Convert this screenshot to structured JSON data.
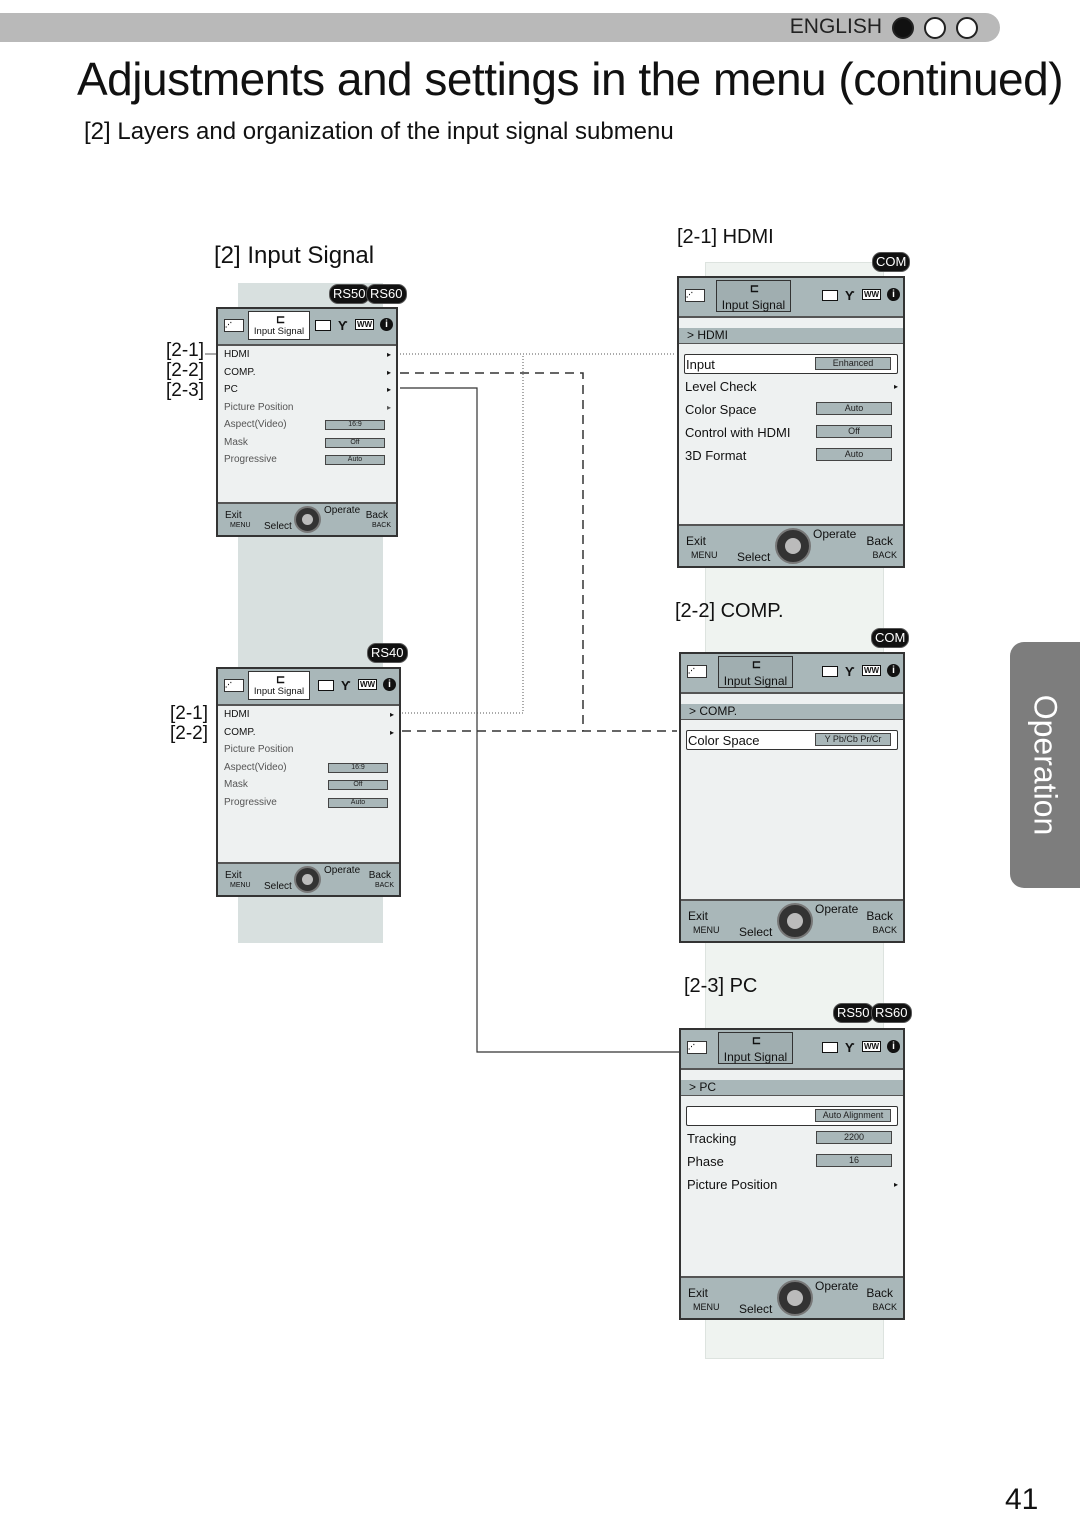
{
  "header": {
    "language": "ENGLISH",
    "language_dots": [
      true,
      false,
      false
    ]
  },
  "title": "Adjustments and settings in the menu (continued)",
  "subtitle": "[2] Layers and organization of the input signal submenu",
  "section_labels": {
    "input_signal": "[2] Input Signal",
    "hdmi": "[2-1] HDMI",
    "comp": "[2-2] COMP.",
    "pc": "[2-3] PC"
  },
  "callouts": {
    "top": [
      "[2-1]",
      "[2-2]",
      "[2-3]"
    ],
    "bottom": [
      "[2-1]",
      "[2-2]"
    ]
  },
  "badges": {
    "rs50": "RS50",
    "rs60": "RS60",
    "rs40": "RS40",
    "com": "COM"
  },
  "side_tab": "Operation",
  "page_number": "41",
  "icons": [
    "picture-adjust-icon",
    "input-signal-icon",
    "installation-icon",
    "display-setup-icon",
    "function-icon",
    "information-icon",
    "setting-knob-icon"
  ],
  "footer": {
    "exit": "Exit",
    "menu": "MENU",
    "select": "Select",
    "operate": "Operate",
    "back": "Back",
    "back_key": "BACK"
  },
  "menus": [
    {
      "id": "m1",
      "tab": "Input Signal",
      "crumb": null,
      "items": [
        {
          "label": "HDMI",
          "arrow": true
        },
        {
          "label": "COMP.",
          "arrow": true
        },
        {
          "label": "PC",
          "arrow": true
        },
        {
          "label": "Picture Position",
          "arrow": true,
          "dim": true
        },
        {
          "label": "Aspect(Video)",
          "value": "16:9",
          "dim": true
        },
        {
          "label": "Mask",
          "value": "Off",
          "dim": true
        },
        {
          "label": "Progressive",
          "value": "Auto",
          "dim": true
        }
      ]
    },
    {
      "id": "m2",
      "tab": "Input Signal",
      "crumb": null,
      "items": [
        {
          "label": "HDMI",
          "arrow": true
        },
        {
          "label": "COMP.",
          "arrow": true
        },
        {
          "label": "Picture Position",
          "dim": true
        },
        {
          "label": "Aspect(Video)",
          "value": "16:9",
          "dim": true
        },
        {
          "label": "Mask",
          "value": "Off",
          "dim": true
        },
        {
          "label": "Progressive",
          "value": "Auto",
          "dim": true
        }
      ]
    },
    {
      "id": "m3",
      "tab": "Input Signal",
      "crumb": "HDMI",
      "items": [
        {
          "label": "Input",
          "value": "Enhanced",
          "selected": true
        },
        {
          "label": "Level Check",
          "arrow": true
        },
        {
          "label": "Color Space",
          "value": "Auto"
        },
        {
          "label": "Control with HDMI",
          "value": "Off"
        },
        {
          "label": "3D Format",
          "value": "Auto"
        }
      ]
    },
    {
      "id": "m4",
      "tab": "Input Signal",
      "crumb": "COMP.",
      "items": [
        {
          "label": "Color Space",
          "value": "Y Pb/Cb Pr/Cr",
          "selected": true
        }
      ]
    },
    {
      "id": "m5",
      "tab": "Input Signal",
      "crumb": "PC",
      "items": [
        {
          "label": "",
          "value": "Auto Alignment",
          "selected": true
        },
        {
          "label": "Tracking",
          "value": "2200"
        },
        {
          "label": "Phase",
          "value": "16"
        },
        {
          "label": "Picture Position",
          "arrow": true
        }
      ]
    }
  ]
}
